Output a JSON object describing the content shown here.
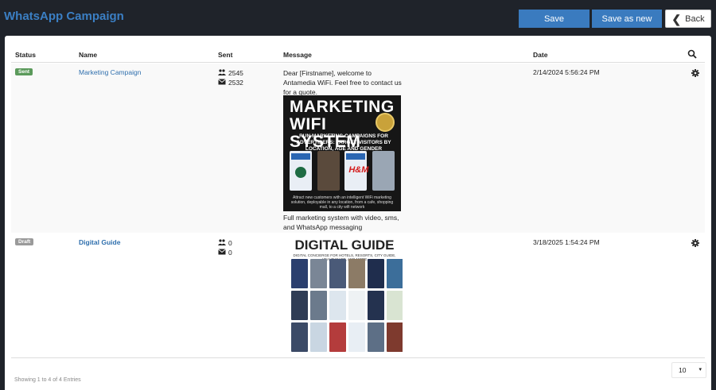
{
  "header": {
    "title": "WhatsApp Campaign",
    "save_label": "Save",
    "save_as_label": "Save as new",
    "back_label": "Back"
  },
  "table": {
    "columns": [
      "Status",
      "Name",
      "Sent",
      "Message",
      "Date"
    ],
    "rows": [
      {
        "status": "Sent",
        "name": "Marketing Campaign",
        "sent_users": "2545",
        "sent_messages": "2532",
        "message": "Dear [Firstname], welcome to Antamedia WiFi. Feel free to contact us for a quote.",
        "poster_title_line1": "MARKETING",
        "poster_title_line2": "WIFI SYSTEM",
        "poster_subtitle": "RUN MARKETING CAMPAIGNS FOR ADVERTISERS: TARGET VISITORS BY LOCATION, AGE AND GENDER",
        "poster_footer": "Attract new customers with an intelligent WiFi marketing solution, deployable in any location, from a cafe, shopping mall, to a city wifi network",
        "message_after": "Full marketing system with video, sms, and WhatsApp messaging",
        "date": "2/14/2024 5:56:24 PM"
      },
      {
        "status": "Draft",
        "name": "Digital Guide",
        "sent_users": "0",
        "sent_messages": "0",
        "poster_title": "DIGITAL GUIDE",
        "poster_subtitle": "DIGITAL CONCIERGE FOR HOTELS, RESORTS, CITY GUIDE, HEALTHCARE, AND MORE",
        "date": "3/18/2025 1:54:24 PM"
      }
    ]
  },
  "footer": {
    "info": "Showing 1 to 4 of 4 Entries",
    "page_size": "10"
  },
  "colors": {
    "background": "#1f232a",
    "accent": "#3a7bbf",
    "title": "#3b7fc4",
    "badge_sent": "#5b9a5b",
    "badge_draft": "#9a9a9a"
  }
}
